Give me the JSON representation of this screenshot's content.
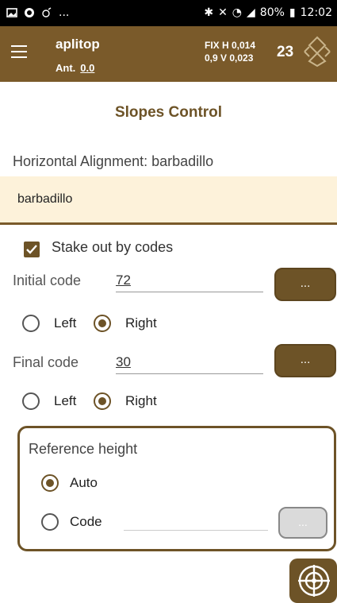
{
  "status_bar": {
    "left_icons": [
      "image-icon",
      "shield-icon",
      "signal-swirl-icon"
    ],
    "left_more": "...",
    "right_icons": [
      "bluetooth-icon",
      "mute-icon",
      "wifi-icon",
      "signal-icon"
    ],
    "battery": "80%",
    "time": "12:02"
  },
  "app_bar": {
    "title": "aplitop",
    "ant_label": "Ant.",
    "ant_value": "0.0",
    "fix_line1": "FIX  H 0,014",
    "fix_line2": "0,9  V 0,023",
    "satellites": "23"
  },
  "page": {
    "title": "Slopes Control",
    "horizontal_alignment_label": "Horizontal Alignment: barbadillo",
    "horizontal_alignment_value": "barbadillo",
    "stake_out_label": "Stake out by codes",
    "stake_out_checked": true,
    "initial_code_label": "Initial code",
    "initial_code_value": "72",
    "initial_button": "...",
    "initial_side_left": "Left",
    "initial_side_right": "Right",
    "initial_selected": "Right",
    "final_code_label": "Final code",
    "final_code_value": "30",
    "final_button": "...",
    "final_side_left": "Left",
    "final_side_right": "Right",
    "final_selected": "Right",
    "reference_height_title": "Reference height",
    "ref_auto_label": "Auto",
    "ref_code_label": "Code",
    "ref_selected": "Auto",
    "ref_button": "..."
  },
  "colors": {
    "brand": "#7a5a2a",
    "accent": "#6d5327",
    "highlight_bg": "#fdf2da"
  }
}
